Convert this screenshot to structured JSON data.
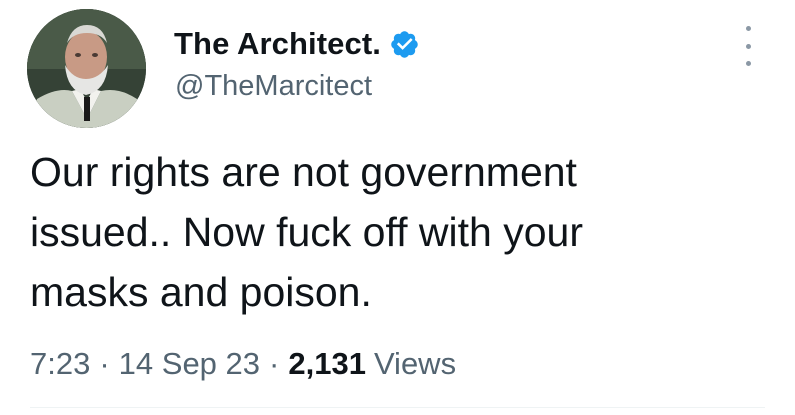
{
  "author": {
    "display_name": "The Architect.",
    "handle": "@TheMarcitect",
    "verified": true,
    "verified_badge_color": "#1d9bf0",
    "avatar_icon": "profile-photo-bearded-man"
  },
  "tweet": {
    "text": "Our rights are not government\nissued.. Now fuck off with your\nmasks and poison."
  },
  "meta": {
    "time": "7:23",
    "separator": "·",
    "date": "14 Sep 23",
    "views_count": "2,131",
    "views_label": "Views"
  },
  "menu": {
    "icon": "more-options-icon"
  }
}
